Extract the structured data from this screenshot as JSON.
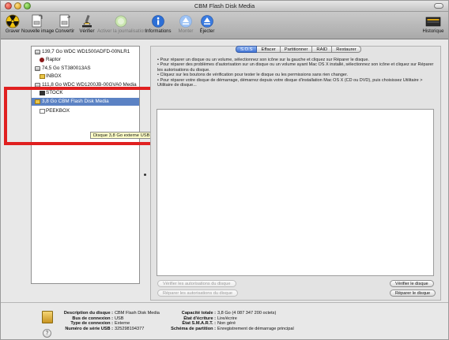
{
  "window": {
    "title": "CBM Flash Disk Media"
  },
  "toolbar": {
    "burn": "Graver",
    "new_image": "Nouvelle image",
    "convert": "Convertir",
    "verify": "Vérifier",
    "journaling": "Activer la journalisation",
    "info": "Informations",
    "mount": "Monter",
    "eject": "Éjecter",
    "history": "Historique"
  },
  "sidebar": {
    "items": [
      {
        "label": "139,7 Go WDC WD1500ADFD-00NLR1"
      },
      {
        "label": "Raptor"
      },
      {
        "label": "74,5 Go ST380013AS"
      },
      {
        "label": "INBOX"
      },
      {
        "label": "111,8 Go WDC WD1200JB-00GVA0 Media"
      },
      {
        "label": "STOCK"
      },
      {
        "label": "3,8 Go CBM Flash Disk Media"
      },
      {
        "label": "PEEKBOX"
      }
    ],
    "tooltip": "Disque 3,8 Go externe USB"
  },
  "tabs": [
    "S.O.S",
    "Effacer",
    "Partitionner",
    "RAID",
    "Restaurer"
  ],
  "info": {
    "lines": [
      "• Pour réparer un disque ou un volume, sélectionnez son icône sur la gauche et cliquez sur Réparer le disque.",
      "• Pour réparer des problèmes d'autorisation sur un disque ou un volume ayant Mac OS X installé, sélectionnez son icône et cliquez sur Réparer les autorisations du disque.",
      "• Cliquez sur les boutons de vérification pour tester le disque ou les permissions sans rien changer.",
      "• Pour réparer votre disque de démarrage, démarrez depuis votre disque d'installation Mac OS X (CD ou DVD), puis choisissez Utilitaire > Utilitaire de disque..."
    ]
  },
  "buttons": {
    "verify_perms": "Vérifier les autorisations du disque",
    "repair_perms": "Réparer les autorisations du disque",
    "verify_disk": "Vérifier le disque",
    "repair_disk": "Réparer le disque"
  },
  "details": {
    "left": [
      {
        "k": "Description du disque :",
        "v": "CBM Flash Disk Media"
      },
      {
        "k": "Bus de connexion :",
        "v": "USB"
      },
      {
        "k": "Type de connexion :",
        "v": "Externe"
      },
      {
        "k": "Numéro de série USB :",
        "v": "325298194377"
      }
    ],
    "right": [
      {
        "k": "Capacité totale :",
        "v": "3,8 Go (4 087 347 200 octets)"
      },
      {
        "k": "État d'écriture :",
        "v": "Lire/écrire"
      },
      {
        "k": "État S.M.A.R.T. :",
        "v": "Non géré"
      },
      {
        "k": "Schéma de partition :",
        "v": "Enregistrement de démarrage principal"
      }
    ]
  },
  "help": "?"
}
